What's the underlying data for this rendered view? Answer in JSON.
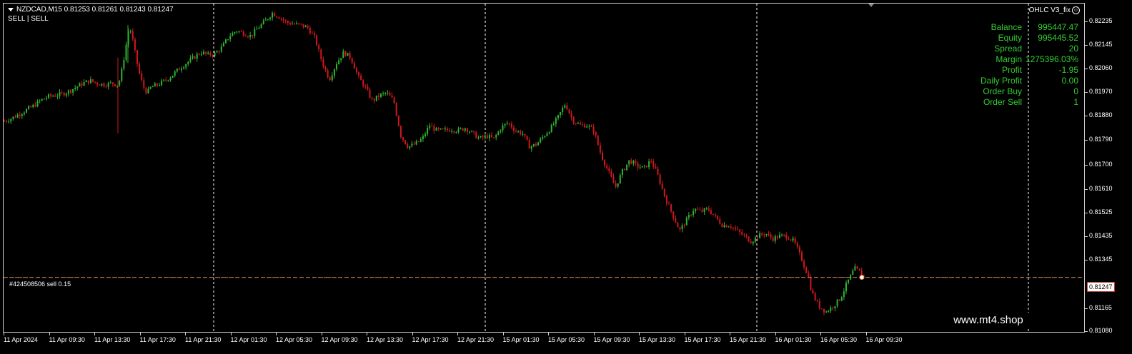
{
  "chart": {
    "symbol_line": "NZDCAD,M15  0.81253 0.81261 0.81243 0.81247",
    "signal_line": "SELL | SELL",
    "ea_name": "OHLC V3_fix",
    "order_label": "#424508506 sell 0.15",
    "current_price": "0.81247",
    "watermark": "www.mt4.shop",
    "colors": {
      "bull": "#2fb52f",
      "bear": "#d0181d",
      "order_line": "#e0783a",
      "panel_text": "#32cd32"
    }
  },
  "info_panel": [
    {
      "label": "Balance",
      "value": "995447.47"
    },
    {
      "label": "Equity",
      "value": "995445.52"
    },
    {
      "label": "Spread",
      "value": "20"
    },
    {
      "label": "Margin",
      "value": "1275396.03%"
    },
    {
      "label": "Profit",
      "value": "-1.95"
    },
    {
      "label": "Daily Profit",
      "value": "0.00"
    },
    {
      "label": "Order Buy",
      "value": "0"
    },
    {
      "label": "Order Sell",
      "value": "1"
    }
  ],
  "price_axis": [
    "0.82235",
    "0.82145",
    "0.82060",
    "0.81970",
    "0.81880",
    "0.81790",
    "0.81700",
    "0.81610",
    "0.81525",
    "0.81435",
    "0.81345",
    "0.81165",
    "0.81080"
  ],
  "time_axis": [
    "11 Apr 2024",
    "11 Apr 09:30",
    "11 Apr 13:30",
    "11 Apr 17:30",
    "11 Apr 21:30",
    "12 Apr 01:30",
    "12 Apr 05:30",
    "12 Apr 09:30",
    "12 Apr 13:30",
    "12 Apr 17:30",
    "12 Apr 21:30",
    "15 Apr 01:30",
    "15 Apr 05:30",
    "15 Apr 09:30",
    "15 Apr 13:30",
    "15 Apr 17:30",
    "15 Apr 21:30",
    "16 Apr 01:30",
    "16 Apr 05:30",
    "16 Apr 09:30"
  ],
  "chart_data": {
    "type": "candlestick",
    "symbol": "NZDCAD",
    "timeframe": "M15",
    "y_range": [
      0.8104,
      0.8226
    ],
    "series": [
      {
        "close_path": [
          [
            0,
            0.81825
          ],
          [
            10,
            0.81835
          ],
          [
            20,
            0.8185
          ],
          [
            30,
            0.81865
          ],
          [
            40,
            0.8188
          ],
          [
            50,
            0.819
          ],
          [
            60,
            0.81915
          ],
          [
            70,
            0.8192
          ],
          [
            80,
            0.81925
          ],
          [
            90,
            0.81935
          ],
          [
            100,
            0.8195
          ],
          [
            110,
            0.81965
          ],
          [
            120,
            0.81975
          ],
          [
            130,
            0.81965
          ],
          [
            140,
            0.8196
          ],
          [
            150,
            0.81965
          ],
          [
            160,
            0.8196
          ],
          [
            165,
            0.8202
          ],
          [
            170,
            0.821
          ],
          [
            175,
            0.8218
          ],
          [
            180,
            0.8212
          ],
          [
            185,
            0.8205
          ],
          [
            190,
            0.8199
          ],
          [
            195,
            0.8195
          ],
          [
            200,
            0.8193
          ],
          [
            205,
            0.8195
          ],
          [
            215,
            0.8196
          ],
          [
            225,
            0.81975
          ],
          [
            235,
            0.81995
          ],
          [
            245,
            0.8202
          ],
          [
            255,
            0.8204
          ],
          [
            265,
            0.8206
          ],
          [
            275,
            0.8208
          ],
          [
            285,
            0.8207
          ],
          [
            295,
            0.82075
          ],
          [
            305,
            0.821
          ],
          [
            315,
            0.8214
          ],
          [
            325,
            0.8216
          ],
          [
            335,
            0.8215
          ],
          [
            345,
            0.8214
          ],
          [
            355,
            0.8217
          ],
          [
            365,
            0.82195
          ],
          [
            375,
            0.82225
          ],
          [
            385,
            0.8221
          ],
          [
            395,
            0.8219
          ],
          [
            405,
            0.82185
          ],
          [
            415,
            0.8218
          ],
          [
            425,
            0.8217
          ],
          [
            435,
            0.8213
          ],
          [
            445,
            0.8204
          ],
          [
            455,
            0.8198
          ],
          [
            465,
            0.8204
          ],
          [
            475,
            0.8208
          ],
          [
            485,
            0.8206
          ],
          [
            495,
            0.8199
          ],
          [
            505,
            0.8195
          ],
          [
            515,
            0.819
          ],
          [
            525,
            0.8192
          ],
          [
            535,
            0.8193
          ],
          [
            545,
            0.819
          ],
          [
            555,
            0.8177
          ],
          [
            565,
            0.8173
          ],
          [
            575,
            0.8174
          ],
          [
            585,
            0.8176
          ],
          [
            595,
            0.8181
          ],
          [
            605,
            0.8179
          ],
          [
            615,
            0.8179
          ],
          [
            625,
            0.81795
          ],
          [
            635,
            0.8179
          ],
          [
            645,
            0.818
          ],
          [
            655,
            0.8178
          ],
          [
            665,
            0.8176
          ],
          [
            675,
            0.8177
          ],
          [
            685,
            0.8176
          ],
          [
            695,
            0.818
          ],
          [
            705,
            0.8182
          ],
          [
            715,
            0.8179
          ],
          [
            725,
            0.8178
          ],
          [
            735,
            0.8173
          ],
          [
            745,
            0.8174
          ],
          [
            755,
            0.8177
          ],
          [
            765,
            0.818
          ],
          [
            775,
            0.8184
          ],
          [
            785,
            0.8189
          ],
          [
            795,
            0.8183
          ],
          [
            805,
            0.8181
          ],
          [
            815,
            0.8181
          ],
          [
            825,
            0.8179
          ],
          [
            835,
            0.817
          ],
          [
            845,
            0.8164
          ],
          [
            855,
            0.8158
          ],
          [
            865,
            0.8164
          ],
          [
            875,
            0.8168
          ],
          [
            885,
            0.8166
          ],
          [
            895,
            0.8165
          ],
          [
            905,
            0.8168
          ],
          [
            915,
            0.8162
          ],
          [
            925,
            0.8154
          ],
          [
            935,
            0.8148
          ],
          [
            945,
            0.8142
          ],
          [
            955,
            0.8146
          ],
          [
            965,
            0.815
          ],
          [
            975,
            0.8149
          ],
          [
            985,
            0.815
          ],
          [
            995,
            0.8147
          ],
          [
            1005,
            0.8144
          ],
          [
            1015,
            0.8144
          ],
          [
            1025,
            0.8142
          ],
          [
            1035,
            0.814
          ],
          [
            1045,
            0.8138
          ],
          [
            1055,
            0.814
          ],
          [
            1065,
            0.8141
          ],
          [
            1075,
            0.8139
          ],
          [
            1085,
            0.814
          ],
          [
            1095,
            0.814
          ],
          [
            1105,
            0.8138
          ],
          [
            1115,
            0.8132
          ],
          [
            1125,
            0.8125
          ],
          [
            1130,
            0.8119
          ],
          [
            1140,
            0.8114
          ],
          [
            1150,
            0.8112
          ],
          [
            1160,
            0.8114
          ],
          [
            1170,
            0.8117
          ],
          [
            1180,
            0.8123
          ],
          [
            1190,
            0.8128
          ],
          [
            1200,
            0.8126
          ],
          [
            1205,
            0.81247
          ]
        ]
      }
    ]
  }
}
